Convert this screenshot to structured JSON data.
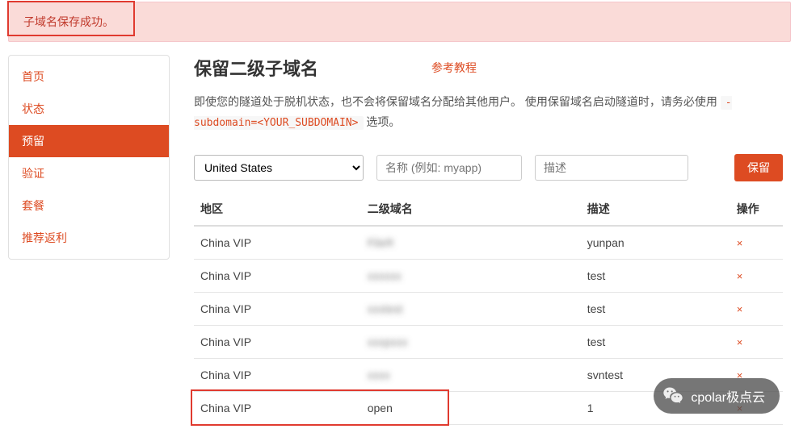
{
  "alert": {
    "text": "子域名保存成功。"
  },
  "sidebar": {
    "items": [
      {
        "label": "首页"
      },
      {
        "label": "状态"
      },
      {
        "label": "预留"
      },
      {
        "label": "验证"
      },
      {
        "label": "套餐"
      },
      {
        "label": "推荐返利"
      }
    ]
  },
  "header": {
    "title": "保留二级子域名",
    "ref_link": "参考教程"
  },
  "description": {
    "line1a": "即使您的隧道处于脱机状态，也不会将保留域名分配给其他用户。 使用保留域名启动隧道时，请务必使用 ",
    "code": "-subdomain=<YOUR_SUBDOMAIN>",
    "line1b": " 选项。"
  },
  "form": {
    "region_selected": "United States",
    "name_placeholder": "名称 (例如: myapp)",
    "desc_placeholder": "描述",
    "reserve_button": "保留"
  },
  "table": {
    "headers": {
      "region": "地区",
      "subdomain": "二级域名",
      "desc": "描述",
      "action": "操作"
    },
    "rows": [
      {
        "region": "China VIP",
        "subdomain": "FileR",
        "blurred": true,
        "desc": "yunpan"
      },
      {
        "region": "China VIP",
        "subdomain": "xxxxxx",
        "blurred": true,
        "desc": "test"
      },
      {
        "region": "China VIP",
        "subdomain": "xxxtest",
        "blurred": true,
        "desc": "test"
      },
      {
        "region": "China VIP",
        "subdomain": "xxxpxxx",
        "blurred": true,
        "desc": "test"
      },
      {
        "region": "China VIP",
        "subdomain": "xxxx",
        "blurred": true,
        "desc": "svntest"
      },
      {
        "region": "China VIP",
        "subdomain": "open",
        "blurred": false,
        "desc": "1"
      }
    ],
    "delete_glyph": "×"
  },
  "badge": {
    "text": "cpolar极点云"
  }
}
